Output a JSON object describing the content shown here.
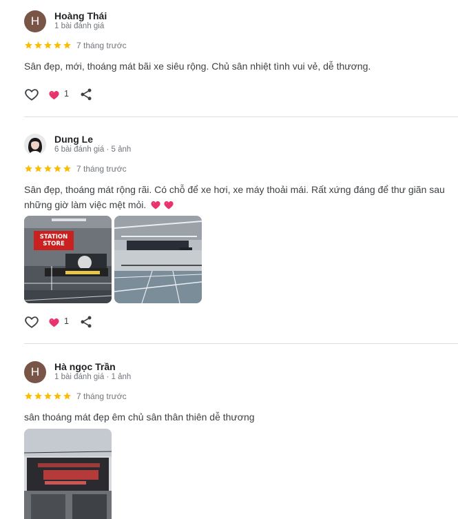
{
  "reviews": [
    {
      "avatar_letter": "H",
      "name": "Hoàng Thái",
      "meta": "1 bài đánh giá",
      "rating": 5,
      "when": "7 tháng trước",
      "text": "Sân đẹp, mới, thoáng mát bãi xe siêu rộng. Chủ sân nhiệt tình vui vẻ, dễ thương.",
      "like_count": "1"
    },
    {
      "avatar_letter": "",
      "name": "Dung Le",
      "meta": "6 bài đánh giá · 5 ảnh",
      "rating": 5,
      "when": "7 tháng trước",
      "text_line1": "Sân đẹp, thoáng mát rộng rãi. Có chỗ để xe hơi, xe máy thoải mái. Rất xứng đáng để thư giãn sau",
      "text_line2": "những giờ làm việc mệt mỏi.",
      "photo1_sign": "STATION STORE",
      "like_count": "1"
    },
    {
      "avatar_letter": "H",
      "name": "Hà ngọc Trần",
      "meta": "1 bài đánh giá · 1 ảnh",
      "rating": 5,
      "when": "7 tháng trước",
      "text": "sân thoáng mát đẹp êm chủ sân thân thiên dễ thương"
    }
  ],
  "colors": {
    "star": "#fbbc04",
    "heart": "#e8336d",
    "avatar_brown": "#795548",
    "divider": "#dadce0"
  },
  "icons": [
    "heart-outline-icon",
    "heart-filled-icon",
    "share-icon",
    "star-icon"
  ]
}
